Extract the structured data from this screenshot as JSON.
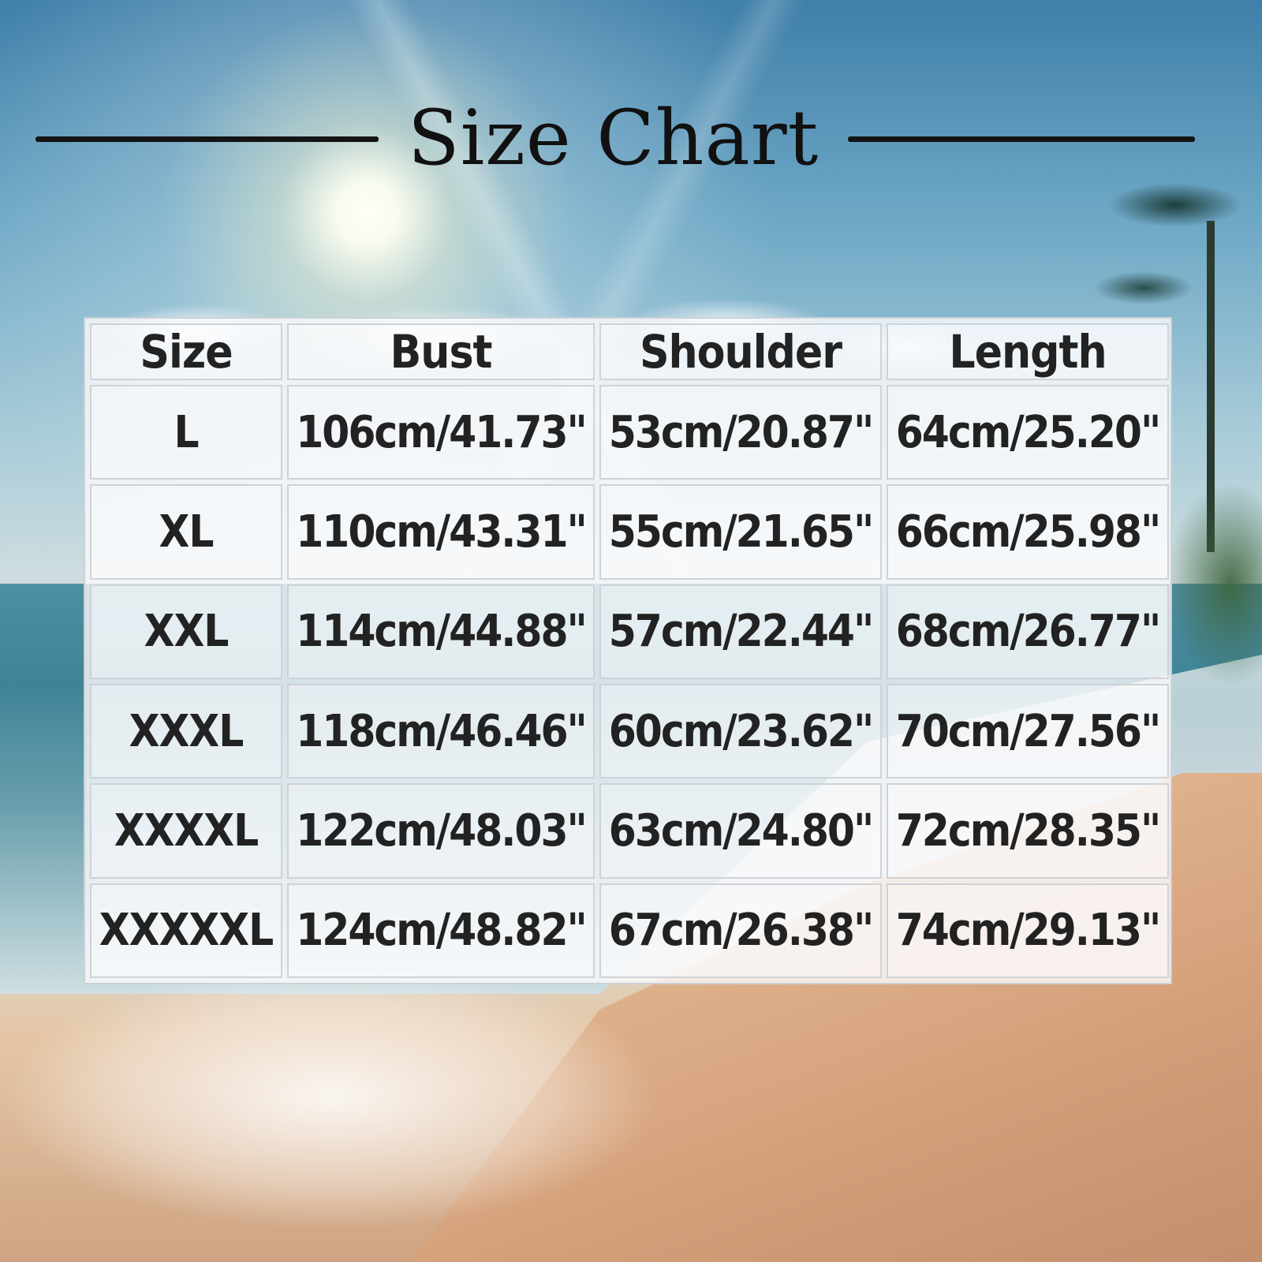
{
  "title": "Size Chart",
  "table": {
    "headers": [
      "Size",
      "Bust",
      "Shoulder",
      "Length"
    ],
    "rows": [
      [
        "L",
        "106cm/41.73\"",
        "53cm/20.87\"",
        "64cm/25.20\""
      ],
      [
        "XL",
        "110cm/43.31\"",
        "55cm/21.65\"",
        "66cm/25.98\""
      ],
      [
        "XXL",
        "114cm/44.88\"",
        "57cm/22.44\"",
        "68cm/26.77\""
      ],
      [
        "XXXL",
        "118cm/46.46\"",
        "60cm/23.62\"",
        "70cm/27.56\""
      ],
      [
        "XXXXL",
        "122cm/48.03\"",
        "63cm/24.80\"",
        "72cm/28.35\""
      ],
      [
        "XXXXXL",
        "124cm/48.82\"",
        "67cm/26.38\"",
        "74cm/29.13\""
      ]
    ]
  },
  "colors": {
    "text": "#222222",
    "title": "#111111",
    "table_panel": "#f5f6f8",
    "cell_border": "#cdd0d4"
  }
}
